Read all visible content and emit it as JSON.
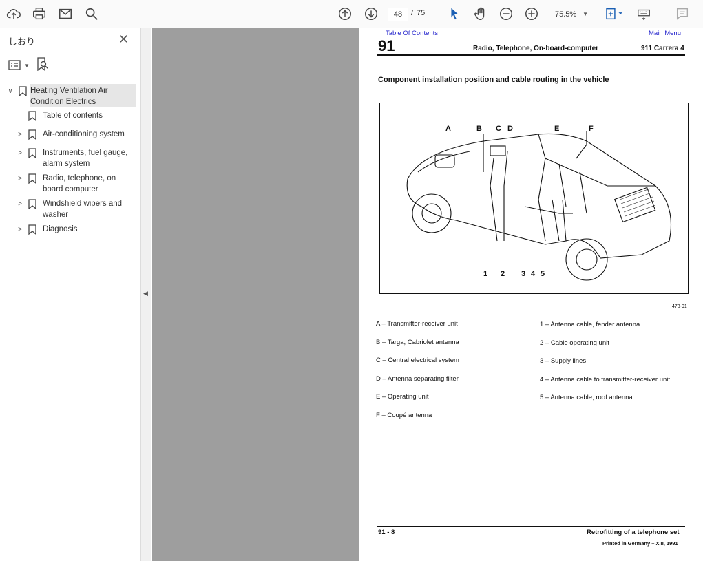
{
  "toolbar": {
    "page_current": "48",
    "page_separator": "/",
    "page_total": "75",
    "zoom": "75.5%"
  },
  "panel": {
    "title": "しおり",
    "bookmarks": [
      {
        "label": "Heating Ventilation Air Condition Electrics",
        "level": 0,
        "expanded": true
      },
      {
        "label": "Table of contents",
        "level": 1,
        "expandable": false
      },
      {
        "label": "Air-conditioning system",
        "level": 1,
        "expandable": true
      },
      {
        "label": "Instruments, fuel gauge, alarm system",
        "level": 1,
        "expandable": true
      },
      {
        "label": "Radio, telephone, on board computer",
        "level": 1,
        "expandable": true
      },
      {
        "label": "Windshield wipers and washer",
        "level": 1,
        "expandable": true
      },
      {
        "label": "Diagnosis",
        "level": 1,
        "expandable": true
      }
    ]
  },
  "document": {
    "link_toc": "Table Of Contents",
    "link_main": "Main Menu",
    "group_number": "91",
    "header_title": "Radio, Telephone, On-board-computer",
    "header_model": "911 Carrera 4",
    "section_title": "Component installation position and cable routing in the vehicle",
    "figure_letters": [
      "A",
      "B",
      "C",
      "D",
      "E",
      "F"
    ],
    "figure_numbers": [
      "1",
      "2",
      "3",
      "4",
      "5"
    ],
    "figure_number": "473-91",
    "legend_left": [
      "A – Transmitter-receiver unit",
      "B – Targa, Cabriolet antenna",
      "C – Central electrical system",
      "D – Antenna separating filter",
      "E – Operating unit",
      "F – Coupé antenna"
    ],
    "legend_right": [
      "1 – Antenna cable, fender antenna",
      "2 – Cable operating unit",
      "3 – Supply lines",
      "4 – Antenna cable to transmitter-receiver unit",
      "5 – Antenna cable, roof antenna"
    ],
    "footer_page": "91 - 8",
    "footer_title": "Retrofitting of a telephone set",
    "footer_printed": "Printed in Germany – XIII, 1991"
  }
}
